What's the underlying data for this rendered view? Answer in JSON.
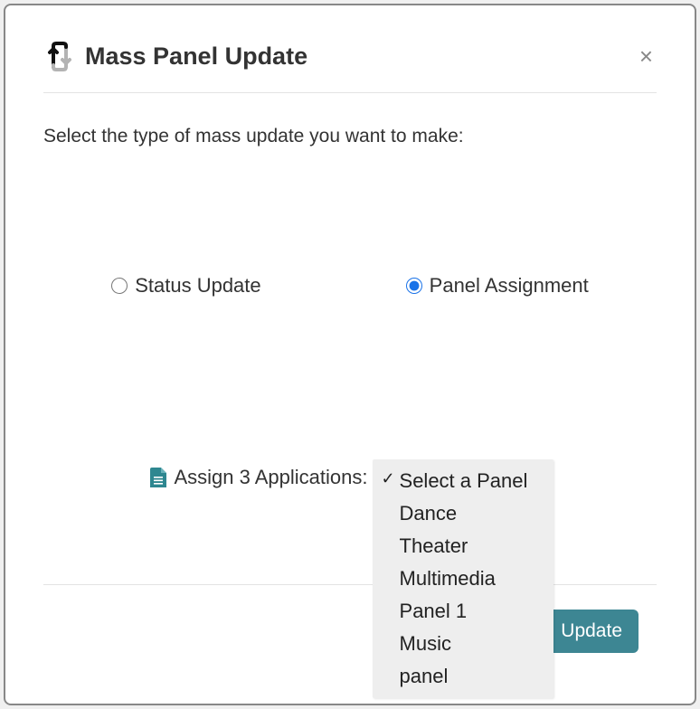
{
  "header": {
    "title": "Mass Panel Update"
  },
  "instruction": "Select the type of mass update you want to make:",
  "radios": {
    "status": {
      "label": "Status Update",
      "checked": false
    },
    "panel": {
      "label": "Panel Assignment",
      "checked": true
    }
  },
  "assign": {
    "label": "Assign 3 Applications:",
    "selected": "Select a Panel",
    "options": [
      "Select a Panel",
      "Dance",
      "Theater",
      "Multimedia",
      "Panel 1",
      "Music",
      "panel"
    ]
  },
  "actions": {
    "update": "Update"
  }
}
